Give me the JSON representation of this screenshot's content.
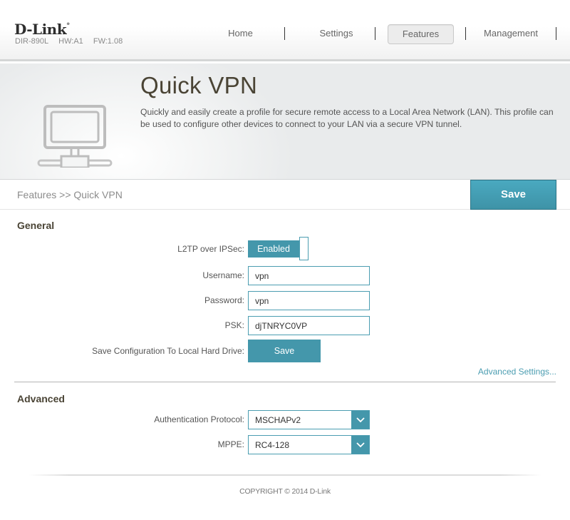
{
  "header": {
    "brand": "D-Link",
    "model": "DIR-890L",
    "hardware": "HW:A1",
    "firmware": "FW:1.08",
    "nav": [
      {
        "label": "Home",
        "active": false
      },
      {
        "label": "Settings",
        "active": false
      },
      {
        "label": "Features",
        "active": true
      },
      {
        "label": "Management",
        "active": false
      }
    ]
  },
  "hero": {
    "icon": "network-computer-icon",
    "title": "Quick VPN",
    "description": "Quickly and easily create a profile for secure remote access to a Local Area Network (LAN). This profile can be used to configure other devices to connect to your LAN via a secure VPN tunnel."
  },
  "breadcrumb": "Features >> Quick VPN",
  "save_label": "Save",
  "general": {
    "title": "General",
    "l2tp": {
      "label": "L2TP over IPSec:",
      "state": "Enabled"
    },
    "username": {
      "label": "Username:",
      "value": "vpn"
    },
    "password": {
      "label": "Password:",
      "value": "vpn"
    },
    "psk": {
      "label": "PSK:",
      "value": "djTNRYC0VP"
    },
    "save_config": {
      "label": "Save Configuration To Local Hard Drive:",
      "button": "Save"
    },
    "advanced_link": "Advanced Settings..."
  },
  "advanced": {
    "title": "Advanced",
    "auth_protocol": {
      "label": "Authentication Protocol:",
      "value": "MSCHAPv2"
    },
    "mppe": {
      "label": "MPPE:",
      "value": "RC4-128"
    }
  },
  "footer": {
    "copyright": "COPYRIGHT © 2014 D-Link"
  },
  "colors": {
    "accent": "#4497ab",
    "title_text": "#4a4435",
    "link": "#4b9db1"
  }
}
